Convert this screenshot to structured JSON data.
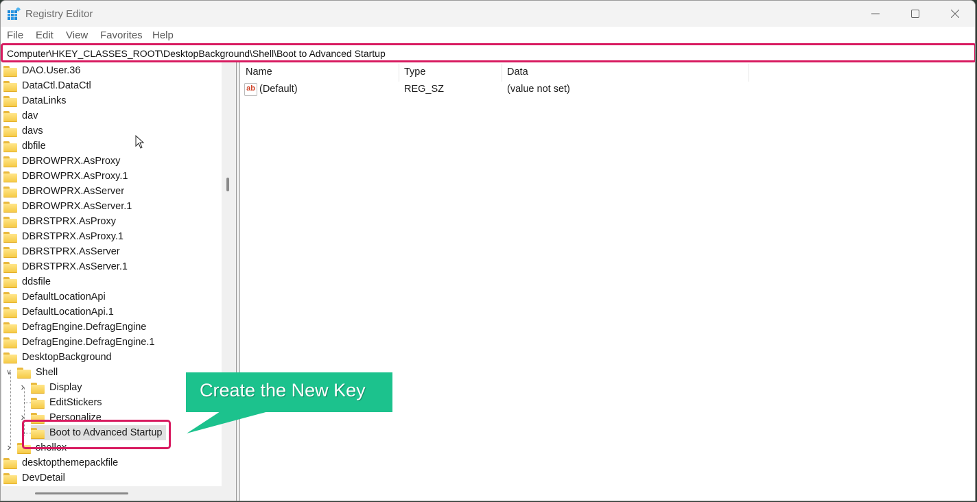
{
  "window": {
    "title": "Registry Editor",
    "icons": {
      "app": "registry-editor-icon",
      "minimize": "minimize-icon",
      "maximize": "maximize-icon",
      "close": "close-icon"
    }
  },
  "menubar": {
    "items": [
      {
        "label": "File"
      },
      {
        "label": "Edit"
      },
      {
        "label": "View"
      },
      {
        "label": "Favorites"
      },
      {
        "label": "Help"
      }
    ]
  },
  "address": {
    "value": "Computer\\HKEY_CLASSES_ROOT\\DesktopBackground\\Shell\\Boot to Advanced Startup"
  },
  "tree": {
    "items": [
      {
        "label": "DAO.User.36",
        "level": 0
      },
      {
        "label": "DataCtl.DataCtl",
        "level": 0
      },
      {
        "label": "DataLinks",
        "level": 0
      },
      {
        "label": "dav",
        "level": 0
      },
      {
        "label": "davs",
        "level": 0
      },
      {
        "label": "dbfile",
        "level": 0
      },
      {
        "label": "DBROWPRX.AsProxy",
        "level": 0
      },
      {
        "label": "DBROWPRX.AsProxy.1",
        "level": 0
      },
      {
        "label": "DBROWPRX.AsServer",
        "level": 0
      },
      {
        "label": "DBROWPRX.AsServer.1",
        "level": 0
      },
      {
        "label": "DBRSTPRX.AsProxy",
        "level": 0
      },
      {
        "label": "DBRSTPRX.AsProxy.1",
        "level": 0
      },
      {
        "label": "DBRSTPRX.AsServer",
        "level": 0
      },
      {
        "label": "DBRSTPRX.AsServer.1",
        "level": 0
      },
      {
        "label": "ddsfile",
        "level": 0
      },
      {
        "label": "DefaultLocationApi",
        "level": 0
      },
      {
        "label": "DefaultLocationApi.1",
        "level": 0
      },
      {
        "label": "DefragEngine.DefragEngine",
        "level": 0
      },
      {
        "label": "DefragEngine.DefragEngine.1",
        "level": 0
      },
      {
        "label": "DesktopBackground",
        "level": 0
      },
      {
        "label": "Shell",
        "level": 1,
        "expanded": true
      },
      {
        "label": "Display",
        "level": 2,
        "collapsed": true
      },
      {
        "label": "EditStickers",
        "level": 2
      },
      {
        "label": "Personalize",
        "level": 2,
        "collapsed": true
      },
      {
        "label": "Boot to Advanced Startup",
        "level": 2,
        "selected": true
      },
      {
        "label": "shellex",
        "level": 1,
        "collapsed": true
      },
      {
        "label": "desktopthemepackfile",
        "level": 0
      },
      {
        "label": "DevDetail",
        "level": 0
      }
    ]
  },
  "values": {
    "columns": [
      {
        "label": "Name"
      },
      {
        "label": "Type"
      },
      {
        "label": "Data"
      }
    ],
    "rows": [
      {
        "icon": "ab",
        "name": "(Default)",
        "type": "REG_SZ",
        "data": "(value not set)"
      }
    ]
  },
  "annotation": {
    "callout_text": "Create the New Key",
    "callout_color": "#1cc28d",
    "highlight_color": "#d81b60"
  }
}
